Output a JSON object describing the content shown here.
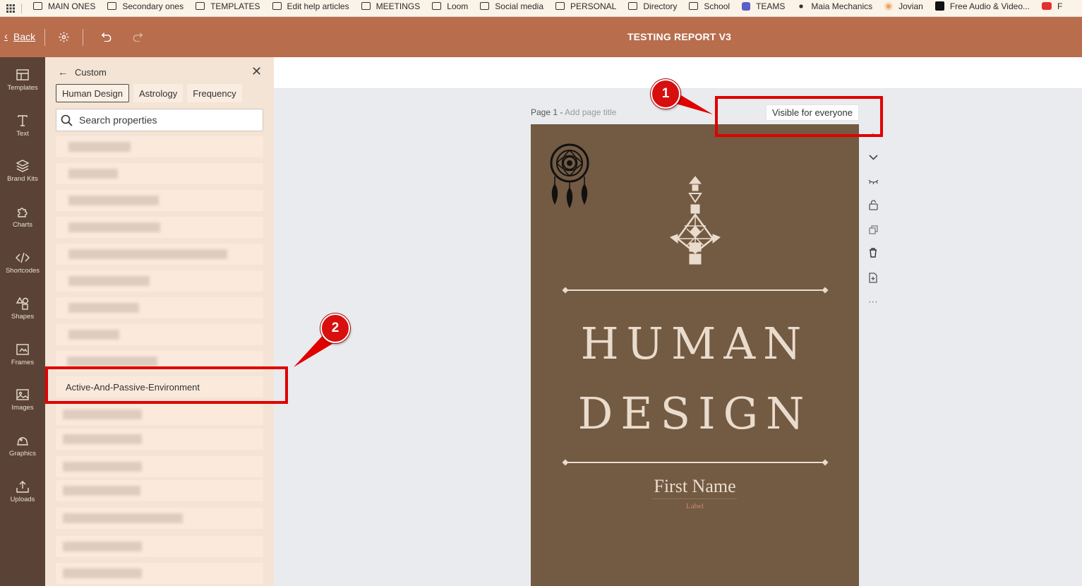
{
  "bookmarks": [
    {
      "label": "MAIN ONES",
      "icon": "folder-icon"
    },
    {
      "label": "Secondary ones",
      "icon": "folder-icon"
    },
    {
      "label": "TEMPLATES",
      "icon": "folder-icon"
    },
    {
      "label": "Edit help articles",
      "icon": "folder-icon"
    },
    {
      "label": "MEETINGS",
      "icon": "folder-icon"
    },
    {
      "label": "Loom",
      "icon": "folder-icon"
    },
    {
      "label": "Social media",
      "icon": "folder-icon"
    },
    {
      "label": "PERSONAL",
      "icon": "folder-icon"
    },
    {
      "label": "Directory",
      "icon": "folder-icon"
    },
    {
      "label": "School",
      "icon": "folder-icon"
    },
    {
      "label": "TEAMS",
      "icon": "teams-icon"
    },
    {
      "label": "Maia Mechanics",
      "icon": "maia-icon"
    },
    {
      "label": "Jovian",
      "icon": "jovian-icon"
    },
    {
      "label": "Free Audio & Video...",
      "icon": "audio-icon"
    },
    {
      "label": "F",
      "icon": "youtube-icon"
    }
  ],
  "topbar": {
    "back_label": "Back",
    "title": "TESTING REPORT V3"
  },
  "rail": [
    {
      "label": "Templates",
      "icon": "templates-icon"
    },
    {
      "label": "Text",
      "icon": "text-icon"
    },
    {
      "label": "Brand Kits",
      "icon": "brand-kits-icon"
    },
    {
      "label": "Charts",
      "icon": "charts-icon"
    },
    {
      "label": "Shortcodes",
      "icon": "shortcodes-icon"
    },
    {
      "label": "Shapes",
      "icon": "shapes-icon"
    },
    {
      "label": "Frames",
      "icon": "frames-icon"
    },
    {
      "label": "Images",
      "icon": "images-icon"
    },
    {
      "label": "Graphics",
      "icon": "graphics-icon"
    },
    {
      "label": "Uploads",
      "icon": "uploads-icon"
    }
  ],
  "panel": {
    "title": "Custom",
    "tabs": [
      "Human Design",
      "Astrology",
      "Frequency"
    ],
    "active_tab": "Human Design",
    "search_placeholder": "Search properties",
    "visible_property": "Active-And-Passive-Environment"
  },
  "canvas": {
    "page_label": "Page 1 -",
    "add_page_title": "Add page title",
    "visibility": "Visible for everyone"
  },
  "page": {
    "title_line1": "HUMAN",
    "title_line2": "DESIGN",
    "first_name": "First Name",
    "label": "Label"
  },
  "annotations": {
    "badge1": "1",
    "badge2": "2"
  },
  "colors": {
    "topbar": "#b86d4d",
    "rail": "#5a4336",
    "panel": "#f4e4d5",
    "page": "#735a43",
    "page_text": "#eadccd",
    "annotation": "#e00000"
  }
}
